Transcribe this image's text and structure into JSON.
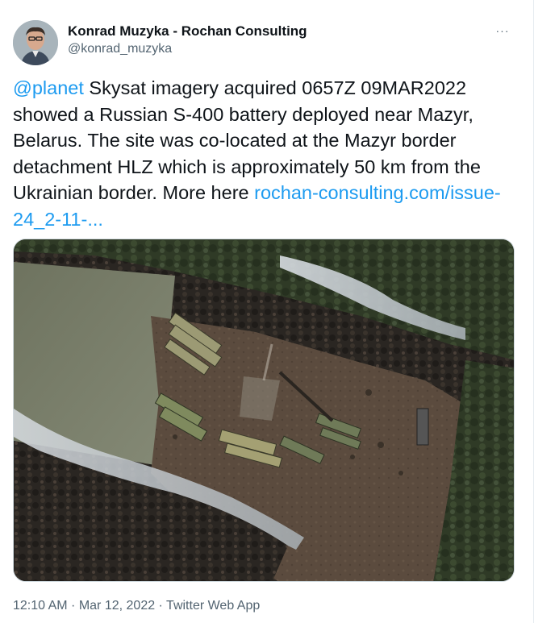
{
  "author": {
    "display_name": "Konrad Muzyka - Rochan Consulting",
    "handle": "@konrad_muzyka"
  },
  "menu": {
    "more_label": "···"
  },
  "tweet": {
    "mention": "@planet",
    "text_main": " Skysat imagery acquired 0657Z 09MAR2022 showed a Russian S-400 battery deployed near Mazyr, Belarus. The site was co-located at the Mazyr border detachment HLZ which is approximately 50 km from the Ukrainian border. More here ",
    "link": "rochan-consulting.com/issue-24_2-11-..."
  },
  "meta": {
    "time": "12:10 AM",
    "separator": " · ",
    "date": "Mar 12, 2022",
    "source": "Twitter Web App"
  },
  "media": {
    "kind": "satellite-image"
  },
  "colors": {
    "link": "#1d9bf0",
    "text": "#0f1419",
    "secondary": "#536471"
  }
}
